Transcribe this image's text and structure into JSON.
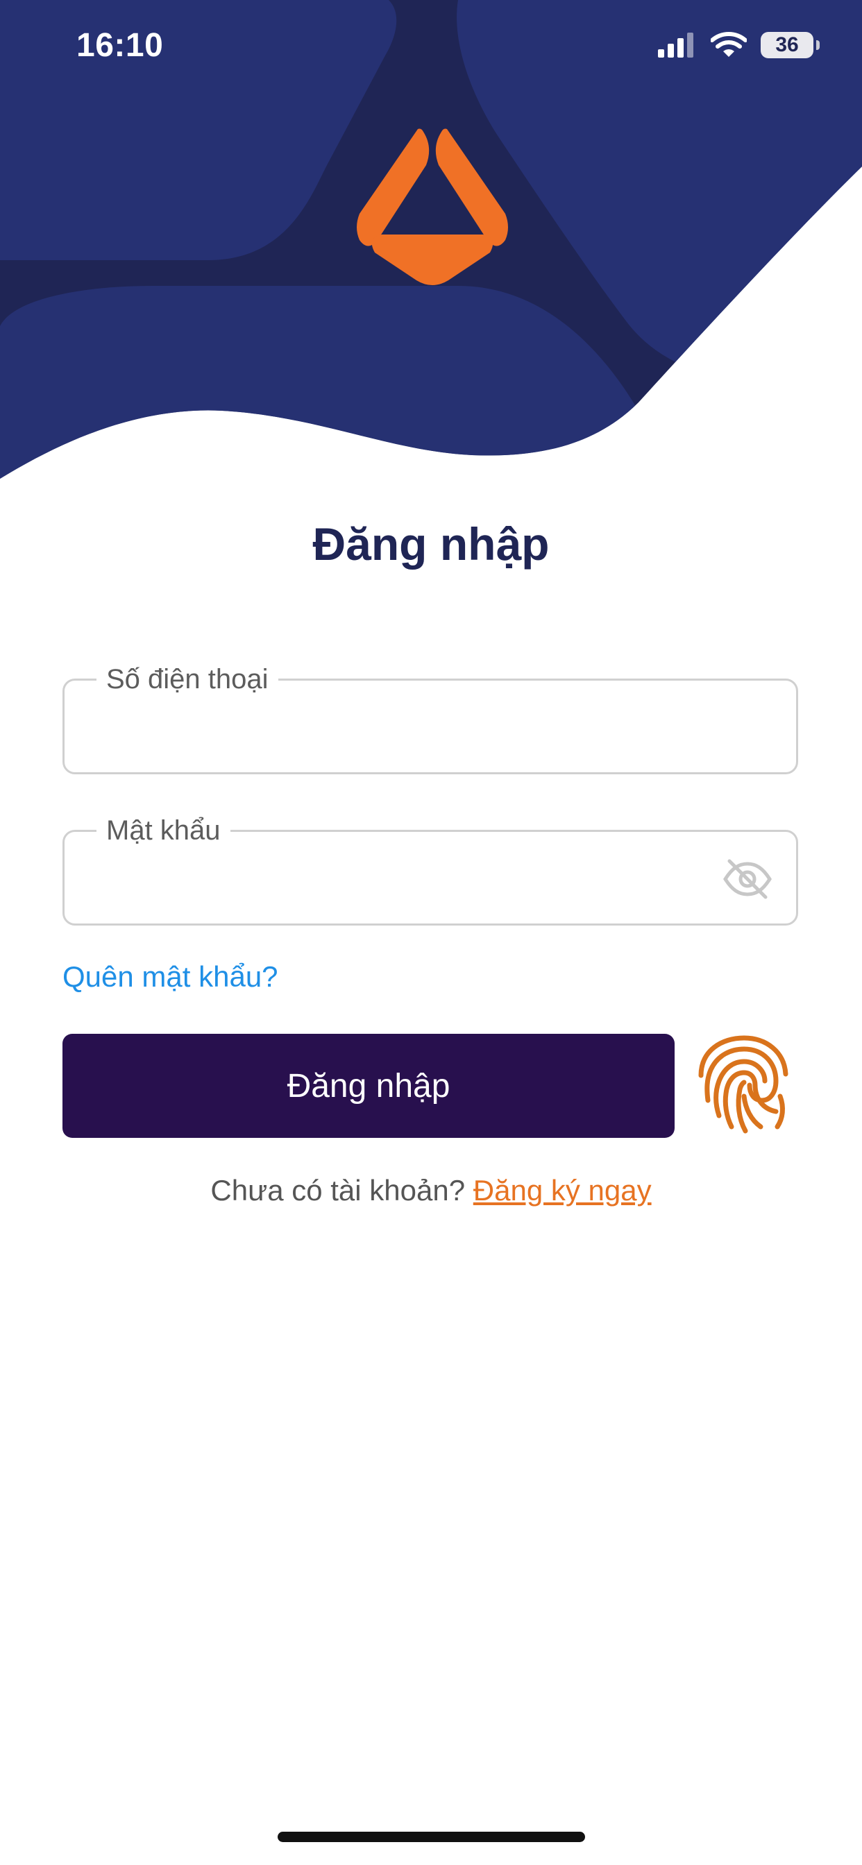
{
  "status_bar": {
    "time": "16:10",
    "battery_level": "36",
    "icons": [
      "cellular-signal-icon",
      "wifi-icon",
      "battery-icon"
    ]
  },
  "header": {
    "logo": "brand-logo",
    "background_color": "#1f2555",
    "accent_color": "#f07126"
  },
  "login_form": {
    "title": "Đăng nhập",
    "phone_field": {
      "label": "Số điện thoại",
      "value": ""
    },
    "password_field": {
      "label": "Mật khẩu",
      "value": "",
      "toggle_icon": "eye-off-icon"
    },
    "forgot_password": "Quên mật khẩu?",
    "submit_label": "Đăng nhập",
    "biometric_icon": "fingerprint-icon",
    "signup_prompt": "Chưa có tài khoản?",
    "signup_link": "Đăng ký ngay"
  },
  "colors": {
    "title": "#1f2555",
    "button": "#28104e",
    "link": "#1f8fe6",
    "signup_link": "#e77322",
    "fingerprint": "#d9731c"
  }
}
